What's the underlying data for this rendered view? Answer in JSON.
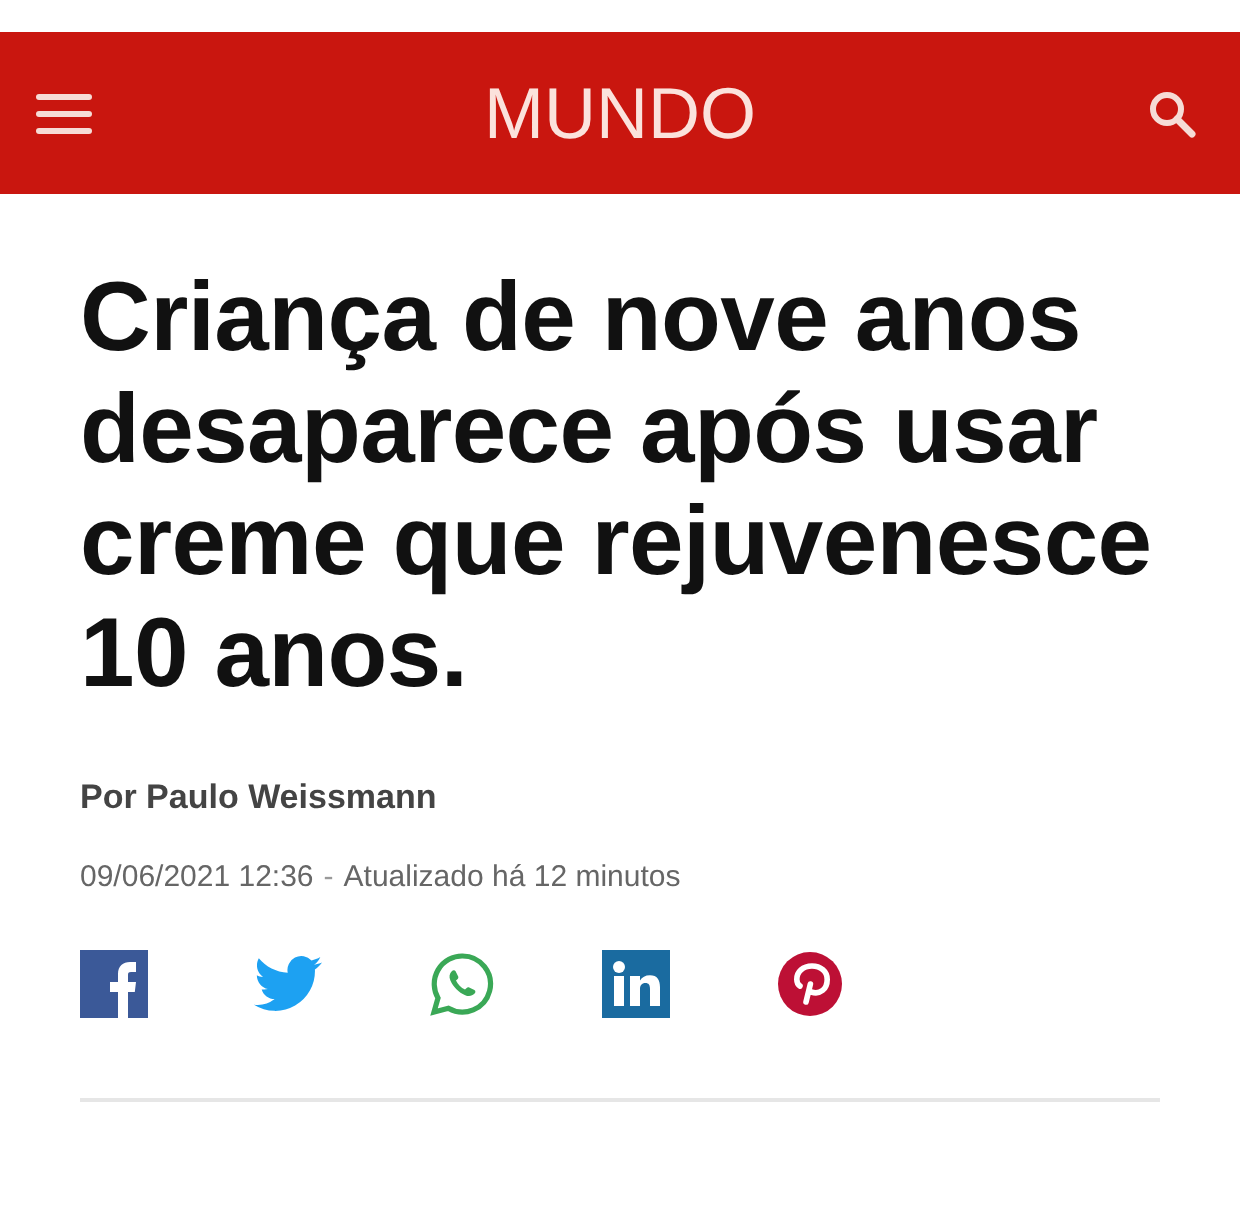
{
  "header": {
    "section": "MUNDO"
  },
  "article": {
    "headline": "Criança de nove anos desaparece após usar creme que rejuvenesce 10 anos.",
    "byline": "Por Paulo Weissmann",
    "date": "09/06/2021 12:36",
    "separator": "-",
    "updated": "Atualizado há 12 minutos"
  },
  "share": [
    {
      "kind": "facebook"
    },
    {
      "kind": "twitter"
    },
    {
      "kind": "whatsapp"
    },
    {
      "kind": "linkedin"
    },
    {
      "kind": "pinterest"
    }
  ]
}
